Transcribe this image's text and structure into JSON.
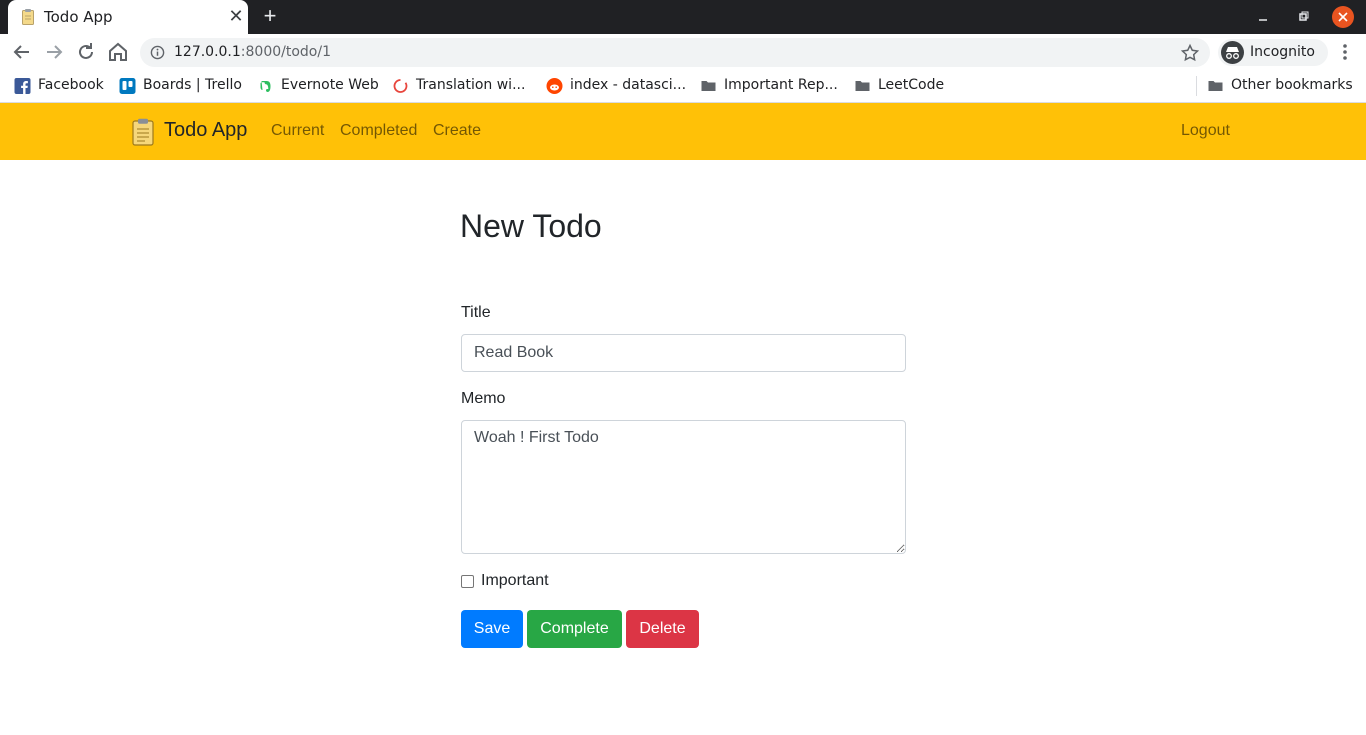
{
  "browser": {
    "tab_title": "Todo App",
    "url_host": "127.0.0.1",
    "url_rest": ":8000/todo/1",
    "profile_label": "Incognito",
    "bookmarks": [
      {
        "label": "Facebook",
        "icon": "facebook-icon"
      },
      {
        "label": "Boards | Trello",
        "icon": "trello-icon"
      },
      {
        "label": "Evernote Web",
        "icon": "evernote-icon"
      },
      {
        "label": "Translation wi...",
        "icon": "translation-icon"
      },
      {
        "label": "index - datasci...",
        "icon": "reddit-icon"
      },
      {
        "label": "Important Rep...",
        "icon": "folder-icon"
      },
      {
        "label": "LeetCode",
        "icon": "folder-icon"
      }
    ],
    "other_bookmarks": "Other bookmarks"
  },
  "navbar": {
    "brand": "Todo App",
    "links": [
      "Current",
      "Completed",
      "Create"
    ],
    "logout": "Logout",
    "color": "#ffc107"
  },
  "form": {
    "page_title": "New Todo",
    "title_label": "Title",
    "title_value": "Read Book",
    "memo_label": "Memo",
    "memo_value": "Woah ! First Todo",
    "important_label": "Important",
    "important_checked": false,
    "save_label": "Save",
    "complete_label": "Complete",
    "delete_label": "Delete"
  },
  "colors": {
    "save": "#007bff",
    "complete": "#28a745",
    "delete": "#dc3545"
  }
}
